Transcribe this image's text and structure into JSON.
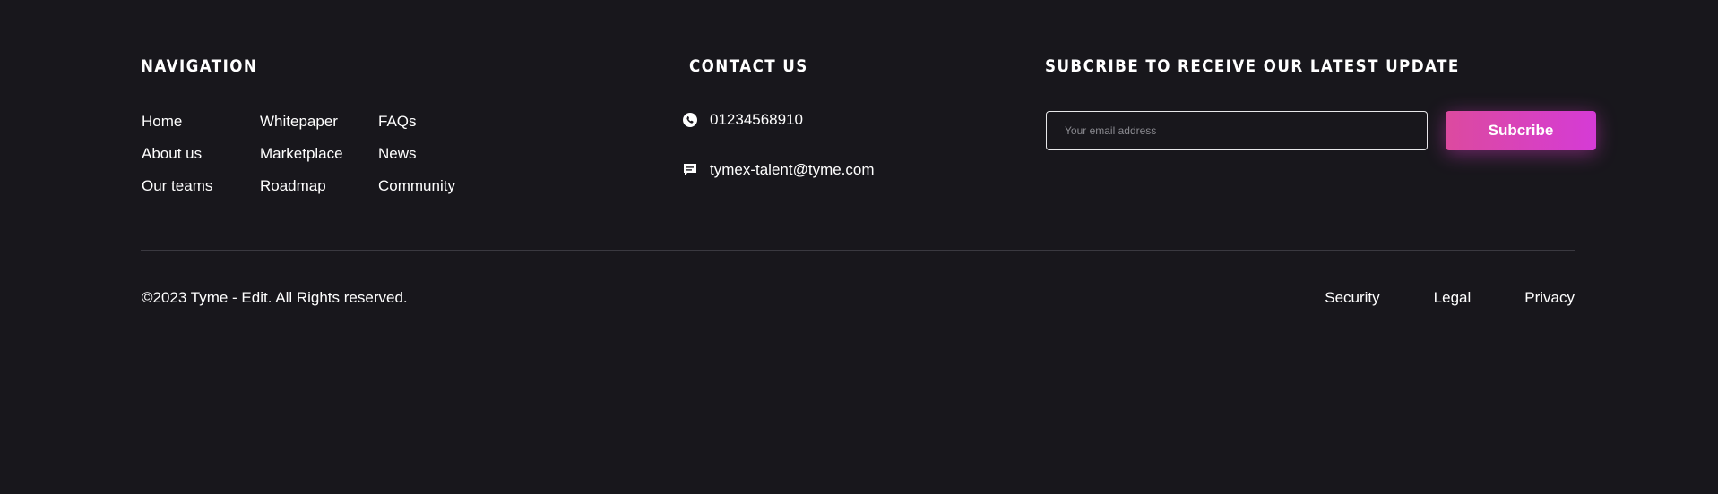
{
  "navigation": {
    "heading": "NAVIGATION",
    "columns": [
      [
        "Home",
        "About us",
        "Our teams"
      ],
      [
        "Whitepaper",
        "Marketplace",
        "Roadmap"
      ],
      [
        "FAQs",
        "News",
        "Community"
      ]
    ]
  },
  "contact": {
    "heading": "CONTACT US",
    "phone": {
      "icon": "phone-icon",
      "text": "01234568910"
    },
    "email": {
      "icon": "message-icon",
      "text": "tymex-talent@tyme.com"
    }
  },
  "subscribe": {
    "heading": "SUBCRIBE TO RECEIVE OUR LATEST UPDATE",
    "placeholder": "Your email address",
    "button_label": "Subcribe"
  },
  "bottom": {
    "copyright": "©2023 Tyme - Edit. All Rights reserved.",
    "links": [
      "Security",
      "Legal",
      "Privacy"
    ]
  },
  "colors": {
    "background": "#18171c",
    "accent_start": "#dc4a9f",
    "accent_end": "#d53bd6",
    "divider": "#3a3940"
  }
}
